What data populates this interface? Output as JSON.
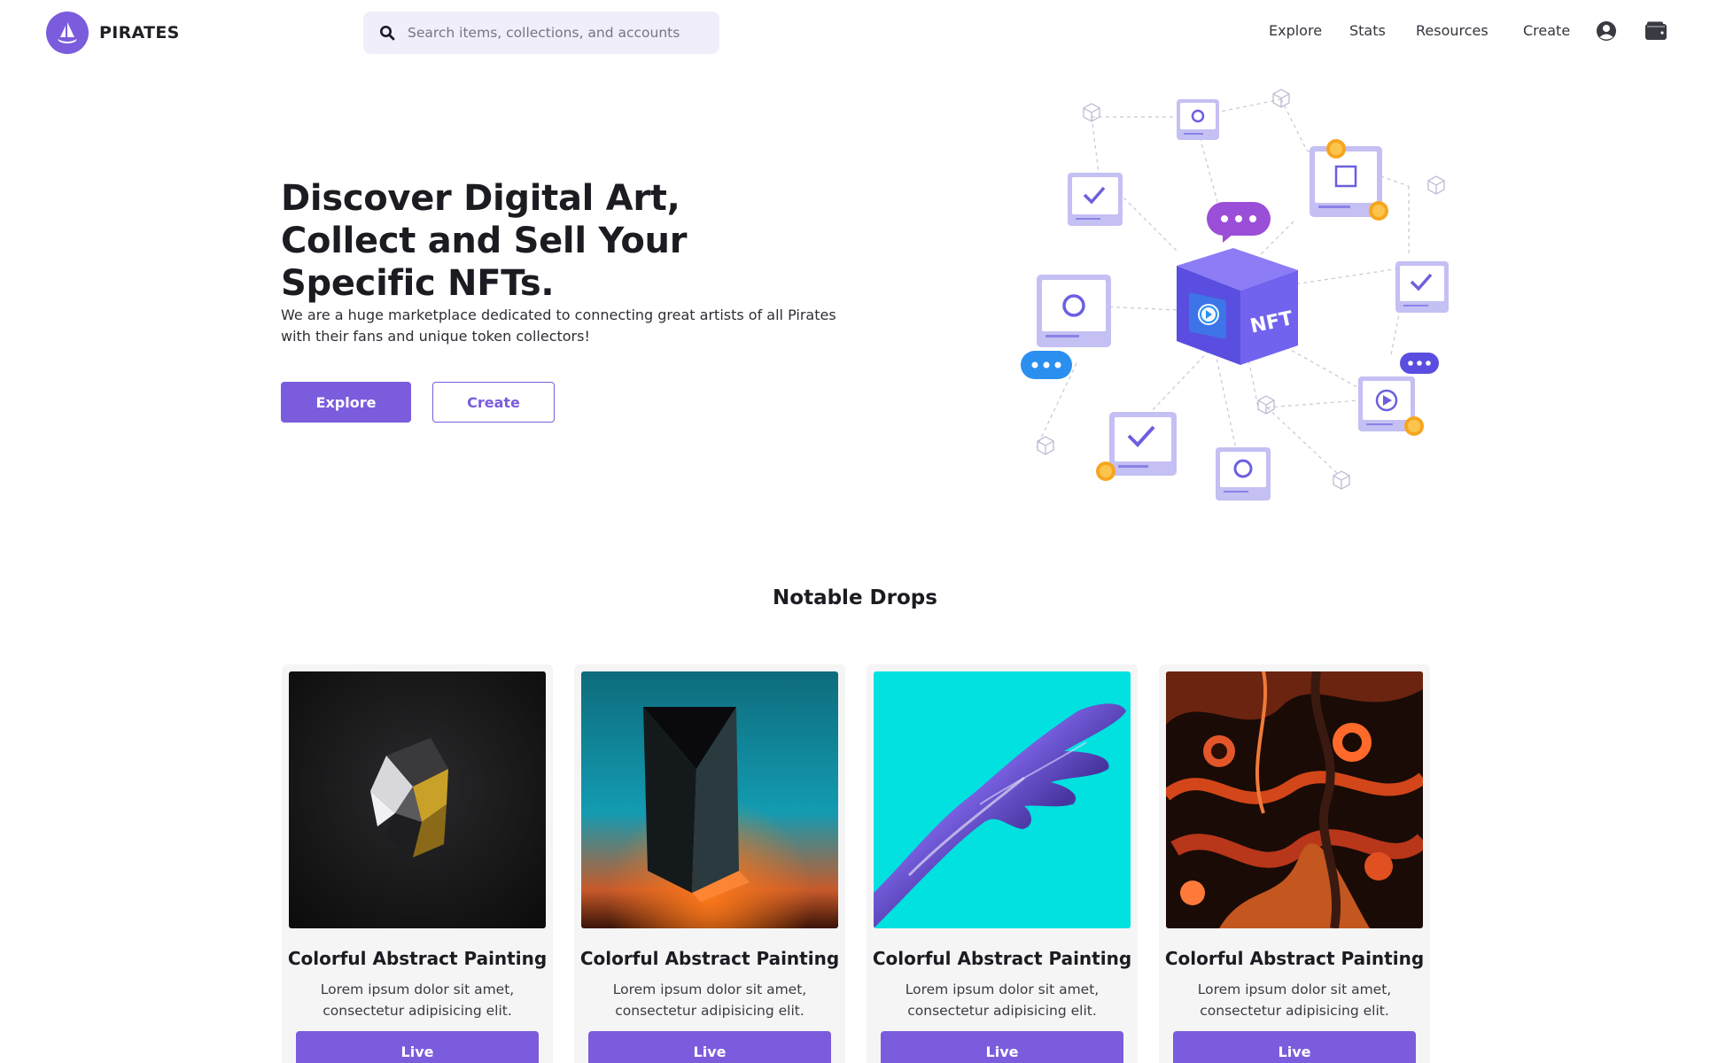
{
  "brand": {
    "name": "PIRATES",
    "logo_icon": "ship-icon",
    "accent": "#7b5cdc"
  },
  "search": {
    "placeholder": "Search items, collections, and accounts",
    "value": ""
  },
  "nav": {
    "links": [
      {
        "label": "Explore"
      },
      {
        "label": "Stats"
      },
      {
        "label": "Resources"
      },
      {
        "label": "Create"
      }
    ],
    "account_icon": "user-circle-icon",
    "wallet_icon": "wallet-icon"
  },
  "hero": {
    "title": "Discover Digital Art, Collect and Sell Your Specific NFTs.",
    "description": "We are a huge marketplace dedicated to connecting great artists of all Pirates with their fans and unique token collectors!",
    "primary_button": "Explore",
    "secondary_button": "Create",
    "illustration_badge": "NFT"
  },
  "notable_drops": {
    "title": "Notable Drops",
    "cards": [
      {
        "title": "Colorful Abstract Painting",
        "description": "Lorem ipsum dolor sit amet, consectetur adipisicing elit.",
        "button": "Live",
        "image": "dark-crystal-art"
      },
      {
        "title": "Colorful Abstract Painting",
        "description": "Lorem ipsum dolor sit amet, consectetur adipisicing elit.",
        "button": "Live",
        "image": "glass-prism-art"
      },
      {
        "title": "Colorful Abstract Painting",
        "description": "Lorem ipsum dolor sit amet, consectetur adipisicing elit.",
        "button": "Live",
        "image": "holographic-hand-art"
      },
      {
        "title": "Colorful Abstract Painting",
        "description": "Lorem ipsum dolor sit amet, consectetur adipisicing elit.",
        "button": "Live",
        "image": "marble-fluid-art"
      }
    ]
  }
}
